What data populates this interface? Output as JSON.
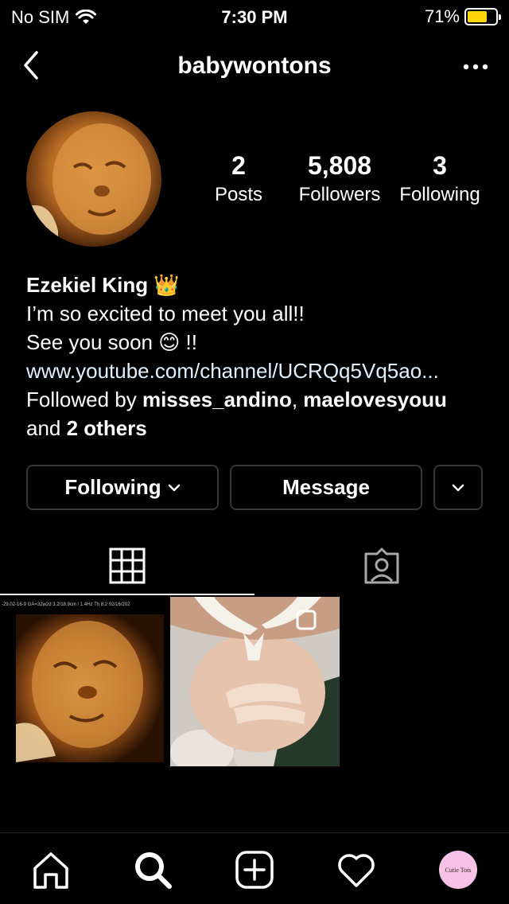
{
  "status_bar": {
    "carrier": "No SIM",
    "time": "7:30 PM",
    "battery_percent": "71%",
    "battery_level": 0.71,
    "battery_color": "#ffd60a"
  },
  "header": {
    "username": "babywontons"
  },
  "stats": {
    "posts_count": "2",
    "posts_label": "Posts",
    "followers_count": "5,808",
    "followers_label": "Followers",
    "following_count": "3",
    "following_label": "Following"
  },
  "bio": {
    "name": "Ezekiel King 👑",
    "line1": "I’m so excited to meet you all!!",
    "line2": "See you soon 😊 !!",
    "link": "www.youtube.com/channel/UCRQq5Vq5ao...",
    "followed_by_prefix": "Followed by ",
    "follower1": "misses_andino",
    "separator": ", ",
    "follower2": "maelovesyouu",
    "and_text": "and ",
    "others": "2 others"
  },
  "buttons": {
    "following": "Following",
    "message": "Message"
  },
  "ultrasound_caption": "-29.02-16-9  GA=32w2d     3.2/18.9cm / 1.4Hz    Th 8.2      02/16/202",
  "bottom_nav": {
    "profile_avatar_text": "Cutie Tots"
  },
  "colors": {
    "background": "#000000",
    "border": "#363636",
    "link": "#e0f1ff",
    "avatar_bg": "#f6c3e6"
  }
}
